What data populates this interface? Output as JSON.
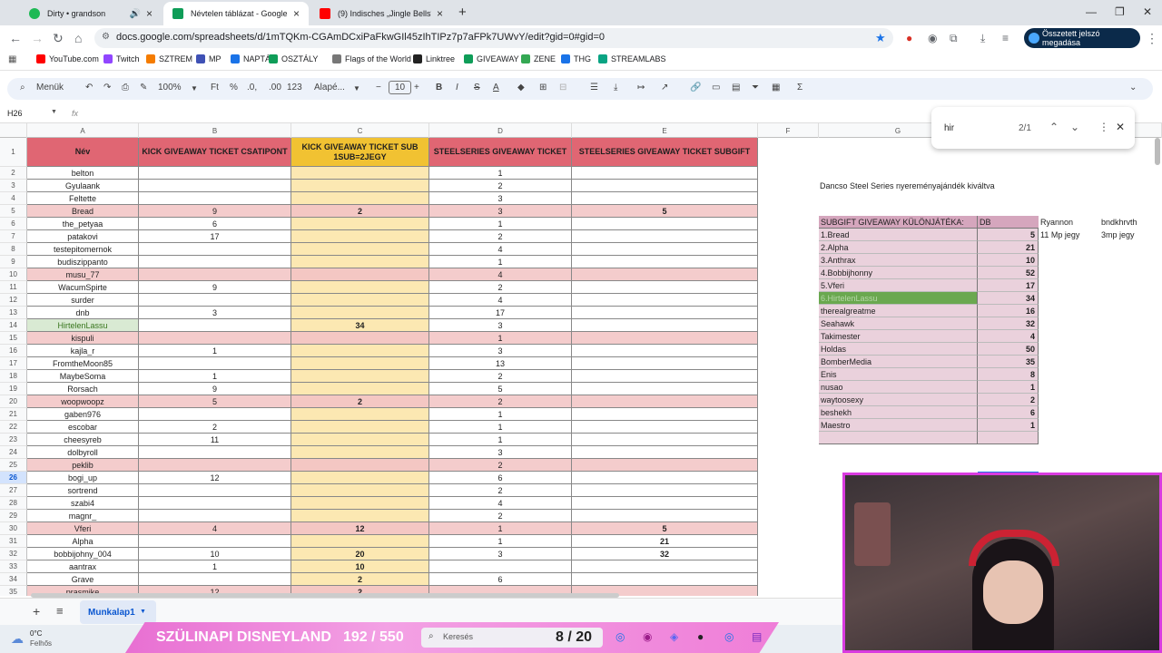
{
  "browser": {
    "tabs": [
      {
        "title": "Dirty • grandson",
        "color": "#1db954",
        "audio": true
      },
      {
        "title": "Névtelen táblázat - Google Táblázatok",
        "color": "#0f9d58",
        "active": true
      },
      {
        "title": "(9) Indisches „Jingle Bells“ 🤗 -",
        "color": "#ff0000"
      }
    ],
    "url": "docs.google.com/spreadsheets/d/1mTQKm-CGAmDCxiPaFkwGIl45zIhTIPz7p7aFPk7UWvY/edit?gid=0#gid=0",
    "password_button": "Összetett jelszó megadása",
    "bookmarks": [
      {
        "label": "YouTube.com",
        "color": "#ff0000"
      },
      {
        "label": "Twitch",
        "color": "#9146ff"
      },
      {
        "label": "SZTREM",
        "color": "#f57c00"
      },
      {
        "label": "MP",
        "color": "#3f51b5"
      },
      {
        "label": "NAPTÁR",
        "color": "#1a73e8"
      },
      {
        "label": "OSZTÁLY",
        "color": "#0f9d58"
      },
      {
        "label": "Flags of the World",
        "color": "#777777"
      },
      {
        "label": "Linktree",
        "color": "#222222"
      },
      {
        "label": "GIVEAWAY",
        "color": "#0f9d58"
      },
      {
        "label": "ZENE",
        "color": "#34a853"
      },
      {
        "label": "THG",
        "color": "#1a73e8"
      },
      {
        "label": "STREAMLABS",
        "color": "#09a483"
      }
    ]
  },
  "toolbar": {
    "menu": "Menük",
    "zoom": "100%",
    "ft": "Ft",
    "percent": "%",
    "dec_less": ".0,",
    "dec_more": ".00",
    "numfmt": "123",
    "font": "Alapé...",
    "size": "10",
    "bold": "B",
    "italic": "I",
    "strike": "S",
    "sigma": "Σ"
  },
  "formula": {
    "cell": "H26",
    "fx": "fx"
  },
  "find": {
    "query": "hir",
    "count": "2/1"
  },
  "columns": [
    "A",
    "B",
    "C",
    "D",
    "E",
    "F",
    "G"
  ],
  "headers": {
    "a": "Név",
    "b": "KICK GIVEAWAY TICKET CSATIPONT",
    "c": "KICK GIVEAWAY TICKET SUB 1SUB=2JEGY",
    "d": "STEELSERIES GIVEAWAY TICKET",
    "e": "STEELSERIES GIVEAWAY TICKET SUBGIFT"
  },
  "rows": [
    {
      "n": "2",
      "a": "belton",
      "b": "",
      "c": "",
      "d": "1",
      "e": "",
      "hl": false
    },
    {
      "n": "3",
      "a": "Gyulaank",
      "b": "",
      "c": "",
      "d": "2",
      "e": "",
      "hl": false
    },
    {
      "n": "4",
      "a": "Feltette",
      "b": "",
      "c": "",
      "d": "3",
      "e": "",
      "hl": false
    },
    {
      "n": "5",
      "a": "Bread",
      "b": "9",
      "c": "2",
      "d": "3",
      "e": "5",
      "hl": true
    },
    {
      "n": "6",
      "a": "the_petyaa",
      "b": "6",
      "c": "",
      "d": "1",
      "e": "",
      "hl": false
    },
    {
      "n": "7",
      "a": "patakovi",
      "b": "17",
      "c": "",
      "d": "2",
      "e": "",
      "hl": false
    },
    {
      "n": "8",
      "a": "testepitomernok",
      "b": "",
      "c": "",
      "d": "4",
      "e": "",
      "hl": false
    },
    {
      "n": "9",
      "a": "budiszippanto",
      "b": "",
      "c": "",
      "d": "1",
      "e": "",
      "hl": false
    },
    {
      "n": "10",
      "a": "musu_77",
      "b": "",
      "c": "",
      "d": "4",
      "e": "",
      "hl": true
    },
    {
      "n": "11",
      "a": "WacumSpirte",
      "b": "9",
      "c": "",
      "d": "2",
      "e": "",
      "hl": false
    },
    {
      "n": "12",
      "a": "surder",
      "b": "",
      "c": "",
      "d": "4",
      "e": "",
      "hl": false
    },
    {
      "n": "13",
      "a": "dnb",
      "b": "3",
      "c": "",
      "d": "17",
      "e": "",
      "hl": false
    },
    {
      "n": "14",
      "a": "HirtelenLassu",
      "b": "",
      "c": "34",
      "d": "3",
      "e": "",
      "hl": false,
      "green": true
    },
    {
      "n": "15",
      "a": "kispuli",
      "b": "",
      "c": "",
      "d": "1",
      "e": "",
      "hl": true
    },
    {
      "n": "16",
      "a": "kajla_r",
      "b": "1",
      "c": "",
      "d": "3",
      "e": "",
      "hl": false
    },
    {
      "n": "17",
      "a": "FromtheMoon85",
      "b": "",
      "c": "",
      "d": "13",
      "e": "",
      "hl": false
    },
    {
      "n": "18",
      "a": "MaybeSoma",
      "b": "1",
      "c": "",
      "d": "2",
      "e": "",
      "hl": false
    },
    {
      "n": "19",
      "a": "Rorsach",
      "b": "9",
      "c": "",
      "d": "5",
      "e": "",
      "hl": false
    },
    {
      "n": "20",
      "a": "woopwoopz",
      "b": "5",
      "c": "2",
      "d": "2",
      "e": "",
      "hl": true
    },
    {
      "n": "21",
      "a": "gaben976",
      "b": "",
      "c": "",
      "d": "1",
      "e": "",
      "hl": false
    },
    {
      "n": "22",
      "a": "escobar",
      "b": "2",
      "c": "",
      "d": "1",
      "e": "",
      "hl": false
    },
    {
      "n": "23",
      "a": "cheesyreb",
      "b": "11",
      "c": "",
      "d": "1",
      "e": "",
      "hl": false
    },
    {
      "n": "24",
      "a": "dolbyroll",
      "b": "",
      "c": "",
      "d": "3",
      "e": "",
      "hl": false
    },
    {
      "n": "25",
      "a": "peklib",
      "b": "",
      "c": "",
      "d": "2",
      "e": "",
      "hl": true
    },
    {
      "n": "26",
      "a": "bogi_up",
      "b": "12",
      "c": "",
      "d": "6",
      "e": "",
      "hl": false
    },
    {
      "n": "27",
      "a": "sortrend",
      "b": "",
      "c": "",
      "d": "2",
      "e": "",
      "hl": false
    },
    {
      "n": "28",
      "a": "szabi4",
      "b": "",
      "c": "",
      "d": "4",
      "e": "",
      "hl": false
    },
    {
      "n": "29",
      "a": "magnr_",
      "b": "",
      "c": "",
      "d": "2",
      "e": "",
      "hl": false
    },
    {
      "n": "30",
      "a": "Vferi",
      "b": "4",
      "c": "12",
      "d": "1",
      "e": "5",
      "hl": true
    },
    {
      "n": "31",
      "a": "Alpha",
      "b": "",
      "c": "",
      "d": "1",
      "e": "21",
      "hl": false
    },
    {
      "n": "32",
      "a": "bobbijohny_004",
      "b": "10",
      "c": "20",
      "d": "3",
      "e": "32",
      "hl": false
    },
    {
      "n": "33",
      "a": "aantrax",
      "b": "1",
      "c": "10",
      "d": "",
      "e": "",
      "hl": false
    },
    {
      "n": "34",
      "a": "Grave",
      "b": "",
      "c": "2",
      "d": "6",
      "e": "",
      "hl": false
    },
    {
      "n": "35",
      "a": "prasmike",
      "b": "12",
      "c": "2",
      "d": "",
      "e": "",
      "hl": true
    }
  ],
  "side": {
    "note": "Dancso Steel Series nyereményajándék kiváltva",
    "title": "SUBGIFT GIVEAWAY KÜLÖNJÁTÉKA:",
    "db": "DB",
    "ryannon": "Ryannon",
    "ryannon_note": "11 Mp jegy",
    "bndk": "bndkhrvth",
    "bndk_note": "3mp jegy",
    "list": [
      {
        "name": "1.Bread",
        "v": "5"
      },
      {
        "name": "2.Alpha",
        "v": "21"
      },
      {
        "name": "3.Anthrax",
        "v": "10"
      },
      {
        "name": "4.Bobbijhonny",
        "v": "52"
      },
      {
        "name": "5.Vferi",
        "v": "17"
      },
      {
        "name": "6.HirtelenLassu",
        "v": "34",
        "green": true
      },
      {
        "name": "therealgreatme",
        "v": "16"
      },
      {
        "name": "Seahawk",
        "v": "32"
      },
      {
        "name": "Takimester",
        "v": "4"
      },
      {
        "name": "Holdas",
        "v": "50"
      },
      {
        "name": "BomberMedia",
        "v": "35"
      },
      {
        "name": "Enis",
        "v": "8"
      },
      {
        "name": "nusao",
        "v": "1"
      },
      {
        "name": "waytoosexy",
        "v": "2"
      },
      {
        "name": "beshekh",
        "v": "6"
      },
      {
        "name": "Maestro",
        "v": "1"
      }
    ]
  },
  "sheet_tab": "Munkalap1",
  "weather": {
    "temp": "0°C",
    "desc": "Felhős"
  },
  "overlay": {
    "title": "SZÜLINAPI DISNEYLAND",
    "progress": "192 / 550",
    "counter": "8 / 20"
  },
  "search_placeholder": "Keresés"
}
